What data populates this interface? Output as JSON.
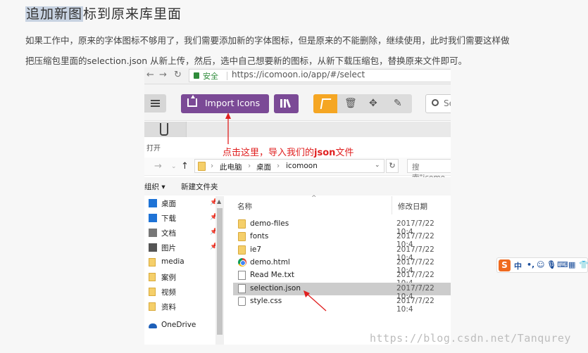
{
  "article": {
    "title_highlight": "追加新图",
    "title_rest": "标到原来库里面",
    "para1": "如果工作中，原来的字体图标不够用了，我们需要添加新的字体图标，但是原来的不能删除，继续使用，此时我们需要这样做",
    "para2": "把压缩包里面的selection.json 从新上传，然后，选中自己想要新的图标，从新下载压缩包，替换原来文件即可。"
  },
  "browser": {
    "secure_label": "安全",
    "url": "https://icomoon.io/app/#/select"
  },
  "toolbar": {
    "import_label": "Import Icons",
    "search_placeholder": "Se"
  },
  "dialog": {
    "title": "打开",
    "annotation_pre": "点击这里，导入我们的",
    "annotation_bold": "json",
    "annotation_post": "文件",
    "breadcrumb": [
      "此电脑",
      "桌面",
      "icomoon"
    ],
    "search_placeholder": "搜索\"icomo",
    "organize": "组织 ▾",
    "new_folder": "新建文件夹",
    "columns": {
      "name": "名称",
      "modified": "修改日期"
    },
    "nav": [
      {
        "label": "桌面",
        "icon": "desktop-icon",
        "pinned": true
      },
      {
        "label": "下载",
        "icon": "download-icon",
        "pinned": true
      },
      {
        "label": "文档",
        "icon": "document-icon",
        "pinned": true
      },
      {
        "label": "图片",
        "icon": "picture-icon",
        "pinned": true
      },
      {
        "label": "media",
        "icon": "folder-icon",
        "pinned": false
      },
      {
        "label": "案例",
        "icon": "folder-icon",
        "pinned": false
      },
      {
        "label": "视频",
        "icon": "folder-icon",
        "pinned": false
      },
      {
        "label": "资料",
        "icon": "folder-icon",
        "pinned": false
      },
      {
        "label": "OneDrive",
        "icon": "onedrive-icon",
        "pinned": false
      }
    ],
    "files": [
      {
        "name": "demo-files",
        "date": "2017/7/22 10:4",
        "type": "folder"
      },
      {
        "name": "fonts",
        "date": "2017/7/22 10:4",
        "type": "folder"
      },
      {
        "name": "ie7",
        "date": "2017/7/22 10:4",
        "type": "folder"
      },
      {
        "name": "demo.html",
        "date": "2017/7/22 10:4",
        "type": "chrome"
      },
      {
        "name": "Read Me.txt",
        "date": "2017/7/22 10:4",
        "type": "doc"
      },
      {
        "name": "selection.json",
        "date": "2017/7/22 10:4",
        "type": "doc",
        "selected": true
      },
      {
        "name": "style.css",
        "date": "2017/7/22 10:4",
        "type": "gear"
      }
    ]
  },
  "ime": {
    "logo": "S",
    "mode": "中"
  },
  "watermark": "https://blog.csdn.net/Tanqurey",
  "colors": {
    "import_button": "#7b4a96",
    "annotation": "#e02020",
    "tool_active": "#f5a623"
  }
}
